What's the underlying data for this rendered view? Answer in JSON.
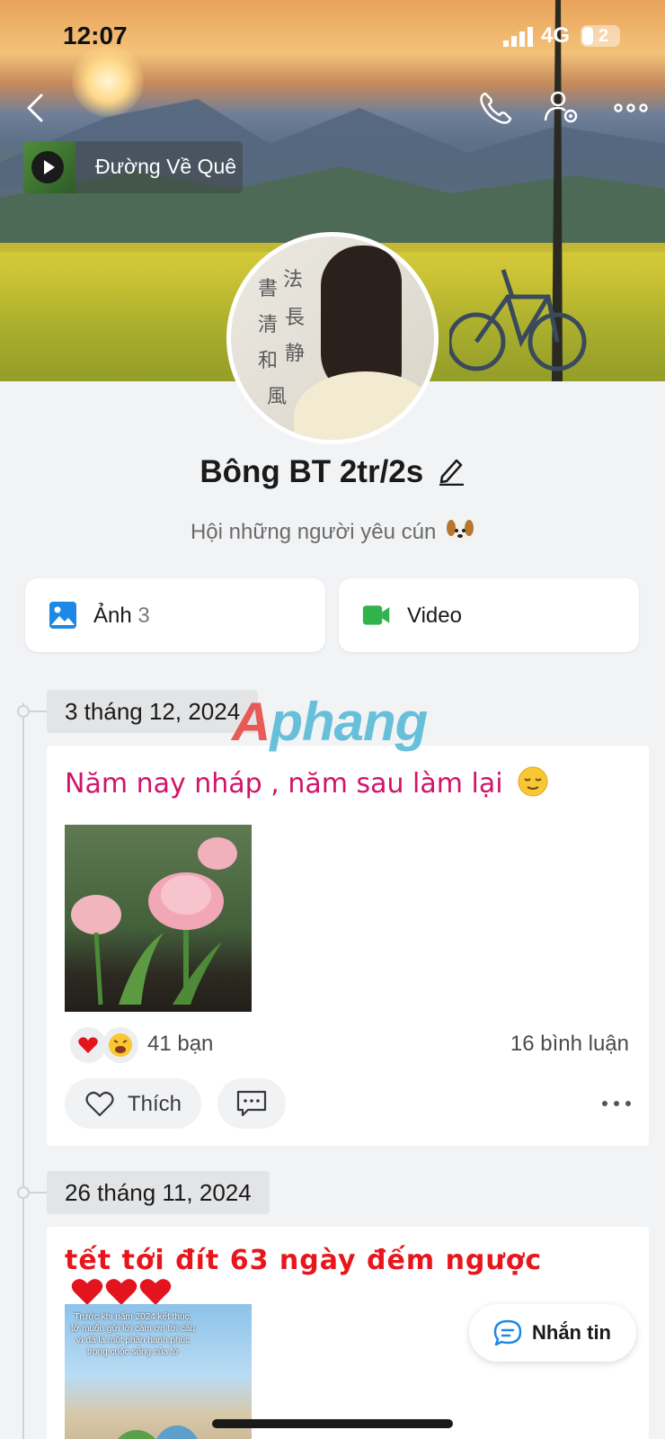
{
  "status_bar": {
    "time": "12:07",
    "network": "4G",
    "battery": "2"
  },
  "music": {
    "title": "Đường Về Quê"
  },
  "profile": {
    "name": "Bông BT 2tr/2s",
    "bio": "Hội những người yêu cún"
  },
  "media": {
    "photos_label": "Ảnh",
    "photos_count": "3",
    "videos_label": "Video"
  },
  "posts": [
    {
      "date": "3 tháng 12, 2024",
      "caption": "Năm nay nháp , năm sau làm lại",
      "reactions": "41 bạn",
      "comments": "16 bình luận",
      "like_label": "Thích"
    },
    {
      "date": "26 tháng 11, 2024",
      "caption": "tết tới đít 63 ngày đếm ngược",
      "image_text": "Trước khi năm 2024 kết thúc, tớ muốn gửi lời cảm ơn tới cậu vì đã là một phần hạnh phúc trong cuộc sống của tớ"
    }
  ],
  "watermark": {
    "a": "A",
    "rest": "phang"
  },
  "message_button": {
    "label": "Nhắn tin"
  },
  "colors": {
    "caption1": "#d0156a",
    "caption2": "#e8161c",
    "photo_icon": "#1e88e5",
    "video_icon": "#2fb34a",
    "message_icon": "#1e88e5"
  }
}
